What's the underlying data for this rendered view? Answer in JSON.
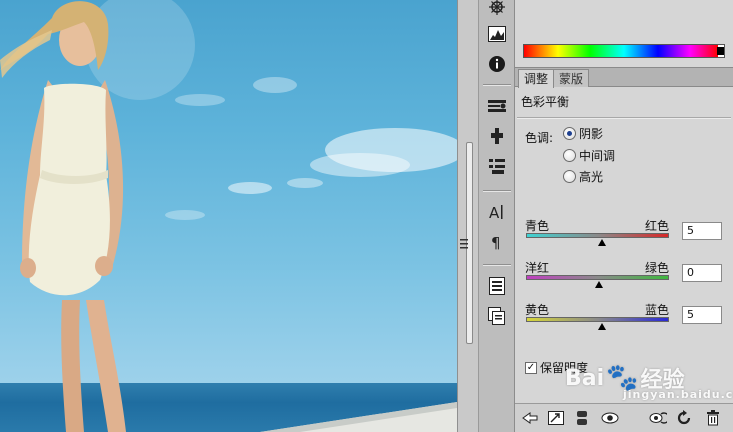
{
  "panel": {
    "tabs": [
      {
        "label": "调整",
        "active": true
      },
      {
        "label": "蒙版",
        "active": false
      }
    ],
    "title": "色彩平衡",
    "tone": {
      "label": "色调:",
      "options": [
        {
          "label": "阴影",
          "selected": true
        },
        {
          "label": "中间调",
          "selected": false
        },
        {
          "label": "高光",
          "selected": false
        }
      ]
    },
    "sliders": [
      {
        "left": "青色",
        "right": "红色",
        "value": "5",
        "position": 0.5
      },
      {
        "left": "洋红",
        "right": "绿色",
        "value": "0",
        "position": 0.48
      },
      {
        "left": "黄色",
        "right": "蓝色",
        "value": "5",
        "position": 0.5
      }
    ],
    "preserve_luminosity": {
      "label": "保留明度",
      "checked": true
    }
  },
  "watermark": {
    "text": "Bai",
    "suffix": "经验",
    "sub": "jingyan.baidu.com"
  },
  "colors": {
    "panel_bg": "#d6d6d6",
    "cyan_red": [
      "#3fd3d3",
      "#d62828"
    ],
    "magenta_green": [
      "#c040c0",
      "#3fb83f"
    ],
    "yellow_blue": [
      "#d6d63a",
      "#2a2ad6"
    ]
  },
  "icons": {
    "tools": [
      "navigator-icon",
      "histogram-icon",
      "info-icon",
      "brush-presets-icon",
      "clone-source-icon",
      "tool-presets-icon",
      "character-icon",
      "paragraph-icon",
      "notes-icon",
      "layer-comps-icon"
    ],
    "bottom": [
      "back-arrow-icon",
      "expand-view-icon",
      "clip-layer-icon",
      "visibility-icon",
      "reset-icon",
      "refresh-icon",
      "delete-icon"
    ]
  }
}
